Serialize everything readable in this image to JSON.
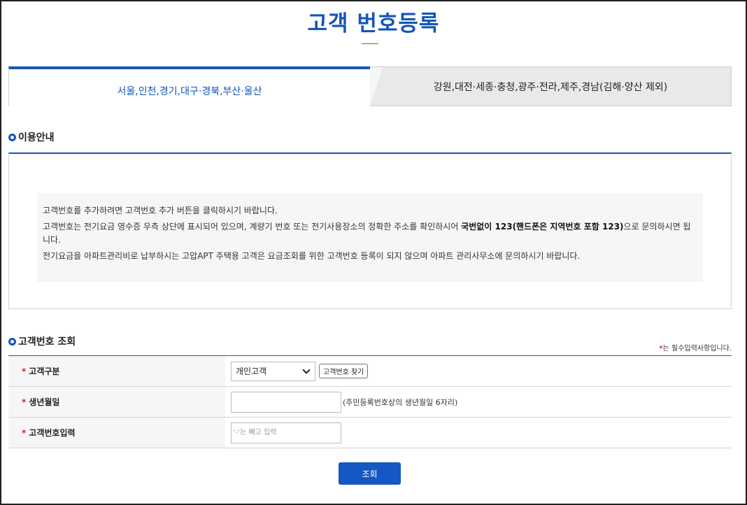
{
  "page": {
    "title": "고객 번호등록"
  },
  "tabs": [
    {
      "label": "서울,인천,경기,대구·경북,부산·울산",
      "active": true
    },
    {
      "label": "강원,대전·세종·충청,광주·전라,제주,경남(김해·양산 제외)",
      "active": false
    }
  ],
  "info": {
    "heading": "이용안내",
    "line1": "고객번호를 추가하려면 고객번호 추가 버튼을 클릭하시기 바랍니다.",
    "line2_prefix": "고객번호는 전기요금 영수증 우측 상단에 표시되어 있으며, 계량기 번호 또는 전기사용장소의 정확한 주소를 확인하시어 ",
    "line2_bold": "국번없이 123(핸드폰은 지역번호 포함 123)",
    "line2_suffix": "으로 문의하시면 됩니다.",
    "line3": "전기요금을 아파트관리비로 납부하시는 고압APT 주택용 고객은 요금조회를 위한 고객번호 등록이 되지 않으며 아파트 관리사무소에 문의하시기 바랍니다."
  },
  "lookup": {
    "heading": "고객번호 조회",
    "required_mark": "*",
    "required_note": "는 필수입력사항입니다.",
    "rows": {
      "customer_type": {
        "label": "고객구분",
        "selected": "개인고객",
        "find_button": "고객번호 찾기"
      },
      "birthdate": {
        "label": "생년월일",
        "value": "",
        "hint": "(주민등록번호상의 생년월일 6자리)"
      },
      "customer_number": {
        "label": "고객번호입력",
        "value": "",
        "placeholder": "'-'는 빼고 입력"
      }
    },
    "submit_label": "조회"
  },
  "colors": {
    "accent": "#1456b8",
    "required": "#dd2222",
    "tab_inactive_bg": "#e9e9e9"
  },
  "icons": {
    "bullet": "circle-bullet-icon",
    "select": "chevron-down-icon"
  }
}
